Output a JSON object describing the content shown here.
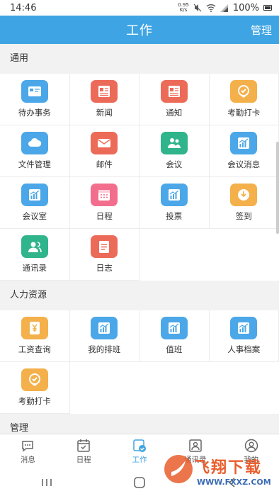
{
  "status": {
    "time": "14:46",
    "net_speed_value": "0.95",
    "net_speed_unit": "K/s",
    "battery": "100%"
  },
  "header": {
    "title": "工作",
    "action": "管理"
  },
  "sections": [
    {
      "title": "通用",
      "items": [
        {
          "label": "待办事务",
          "color": "#4ba7e8",
          "icon": "card-icon"
        },
        {
          "label": "新闻",
          "color": "#ec6a58",
          "icon": "newspaper-icon"
        },
        {
          "label": "通知",
          "color": "#ec6a58",
          "icon": "newspaper-icon"
        },
        {
          "label": "考勤打卡",
          "color": "#f4b04a",
          "icon": "checkin-icon"
        },
        {
          "label": "文件管理",
          "color": "#4ba7e8",
          "icon": "cloud-icon"
        },
        {
          "label": "邮件",
          "color": "#ec6a58",
          "icon": "mail-icon"
        },
        {
          "label": "会议",
          "color": "#2fb48b",
          "icon": "people-icon"
        },
        {
          "label": "会议消息",
          "color": "#4ba7e8",
          "icon": "chart-icon"
        },
        {
          "label": "会议室",
          "color": "#4ba7e8",
          "icon": "chart-icon"
        },
        {
          "label": "日程",
          "color": "#f26e8c",
          "icon": "calendar-icon"
        },
        {
          "label": "投票",
          "color": "#4ba7e8",
          "icon": "chart-icon"
        },
        {
          "label": "签到",
          "color": "#f4b04a",
          "icon": "signin-icon"
        },
        {
          "label": "通讯录",
          "color": "#2fb48b",
          "icon": "contacts-icon"
        },
        {
          "label": "日志",
          "color": "#ec6a58",
          "icon": "log-icon"
        }
      ]
    },
    {
      "title": "人力资源",
      "items": [
        {
          "label": "工资查询",
          "color": "#f4b04a",
          "icon": "yen-icon"
        },
        {
          "label": "我的排班",
          "color": "#4ba7e8",
          "icon": "chart-icon"
        },
        {
          "label": "值班",
          "color": "#4ba7e8",
          "icon": "chart-icon"
        },
        {
          "label": "人事档案",
          "color": "#4ba7e8",
          "icon": "chart-icon"
        },
        {
          "label": "考勤打卡",
          "color": "#f4b04a",
          "icon": "checkin-icon"
        }
      ]
    },
    {
      "title": "管理",
      "items": []
    }
  ],
  "tabs": [
    {
      "label": "消息",
      "icon": "chat-icon",
      "active": false
    },
    {
      "label": "日程",
      "icon": "calendar-icon",
      "active": false
    },
    {
      "label": "工作",
      "icon": "work-icon",
      "active": true
    },
    {
      "label": "通讯录",
      "icon": "contacts-icon",
      "active": false
    },
    {
      "label": "我的",
      "icon": "user-icon",
      "active": false
    }
  ],
  "watermark": {
    "title": "飞翔下载",
    "url": "WWW.FXXZ.COM"
  }
}
